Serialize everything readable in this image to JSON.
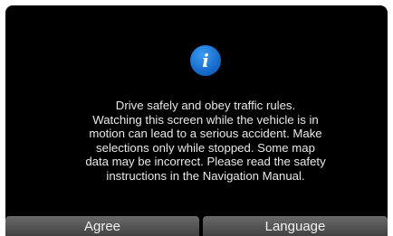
{
  "dialog": {
    "icon": "info-icon",
    "icon_glyph": "i",
    "message_lines": [
      "Drive safely and obey traffic rules.",
      "Watching this screen while the vehicle is in",
      "motion can lead to a serious accident. Make",
      "selections only while stopped. Some map",
      "data may be incorrect. Please read the safety",
      "instructions in the Navigation Manual."
    ]
  },
  "buttons": {
    "agree_label": "Agree",
    "language_label": "Language"
  },
  "colors": {
    "background": "#000000",
    "icon_blue": "#1a6fd0",
    "text": "#e8e8e8",
    "button": "#555555"
  }
}
